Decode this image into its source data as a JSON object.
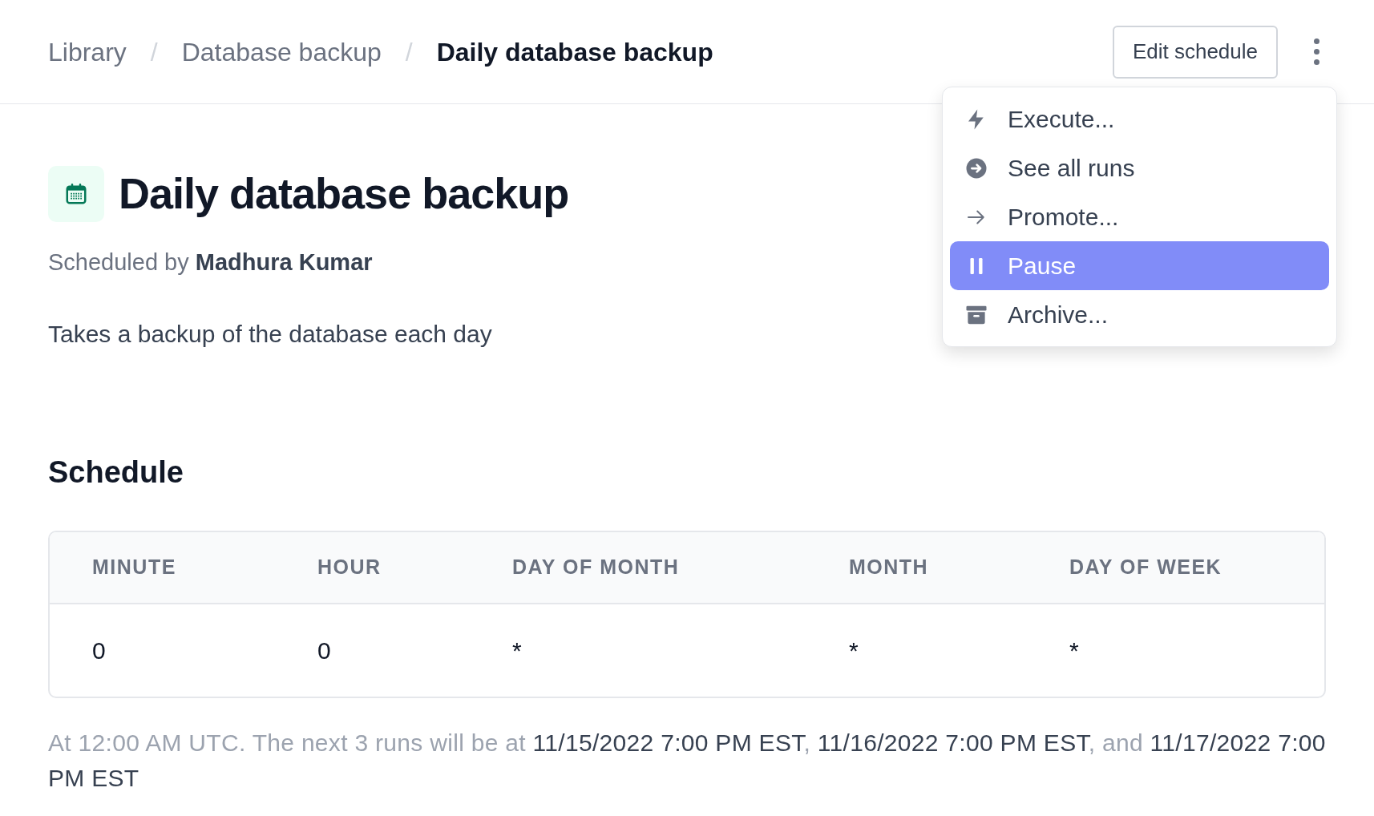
{
  "breadcrumbs": [
    {
      "label": "Library",
      "current": false
    },
    {
      "label": "Database backup",
      "current": false
    },
    {
      "label": "Daily database backup",
      "current": true
    }
  ],
  "separator": "/",
  "actions": {
    "edit_button": "Edit schedule"
  },
  "menu": {
    "items": [
      {
        "kind": "bolt",
        "label": "Execute...",
        "selected": false
      },
      {
        "kind": "circle-arrow",
        "label": "See all runs",
        "selected": false
      },
      {
        "kind": "arrow",
        "label": "Promote...",
        "selected": false
      },
      {
        "kind": "pause",
        "label": "Pause",
        "selected": true
      },
      {
        "kind": "archive",
        "label": "Archive...",
        "selected": false
      }
    ]
  },
  "title": "Daily database backup",
  "scheduled_by": [
    {
      "text": "Scheduled by ",
      "strong": false
    },
    {
      "text": "Madhura Kumar",
      "strong": true
    }
  ],
  "description": "Takes a backup of the database each day",
  "schedule": {
    "heading": "Schedule",
    "table": {
      "columns": [
        "MINUTE",
        "HOUR",
        "DAY OF MONTH",
        "MONTH",
        "DAY OF WEEK"
      ],
      "rows": [
        [
          "0",
          "0",
          "*",
          "*",
          "*"
        ]
      ]
    },
    "summary": [
      {
        "text": "At 12:00 AM UTC. The next 3 runs will be at ",
        "strong": false
      },
      {
        "text": "11/15/2022 7:00 PM EST",
        "strong": true
      },
      {
        "text": ", ",
        "strong": false
      },
      {
        "text": "11/16/2022 7:00 PM EST",
        "strong": true
      },
      {
        "text": ", and ",
        "strong": false
      },
      {
        "text": "11/17/2022 7:00 PM EST",
        "strong": true
      }
    ]
  }
}
